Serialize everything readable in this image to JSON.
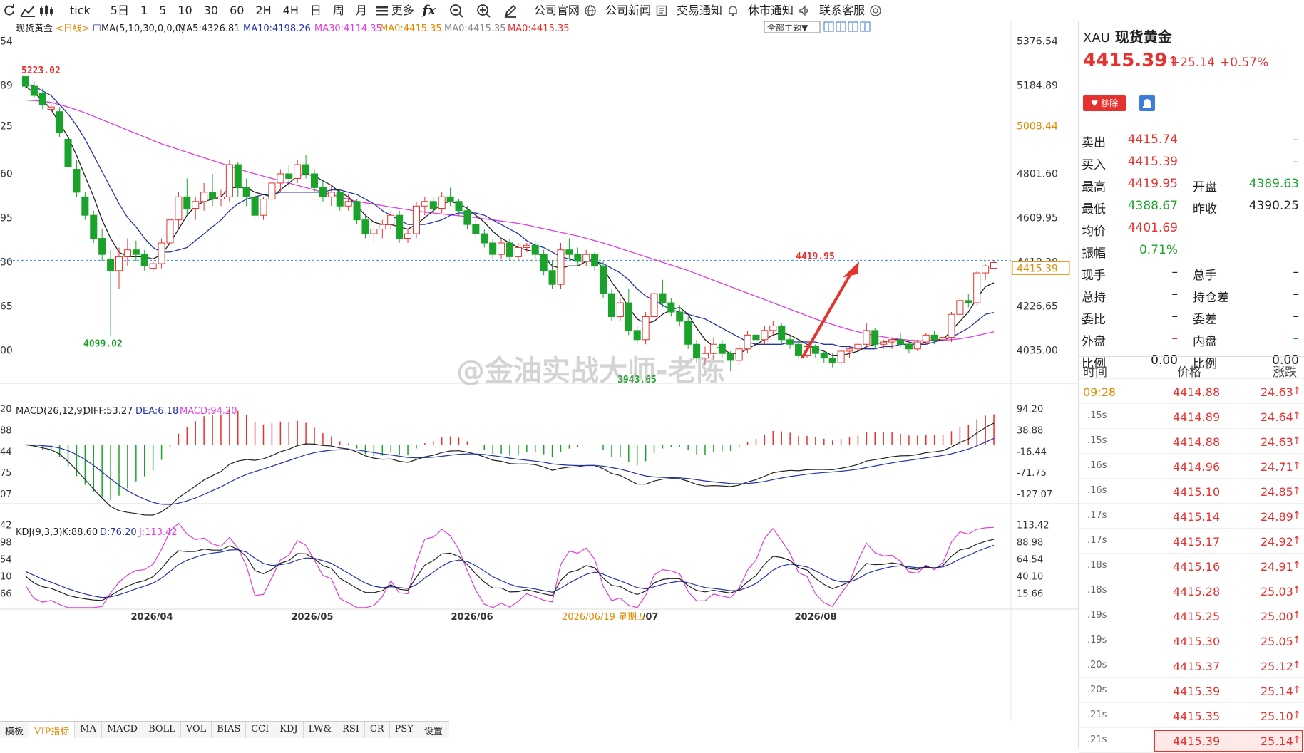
{
  "toolbar": {
    "items": [
      "tick",
      "5日",
      "1",
      "5",
      "10",
      "30",
      "60",
      "2H",
      "4H",
      "日",
      "周",
      "月",
      "更多",
      "公司官网",
      "公司新闻",
      "交易通知",
      "休市通知",
      "联系客服"
    ]
  },
  "chart_header": {
    "title": "现货黄金",
    "period": "<日线>",
    "ma_label": "MA(5,10,30,0,0,0)",
    "ma5": "MA5:4326.81",
    "ma10": "MA10:4198.26",
    "ma30": "MA30:4114.35",
    "ma0a": "MA0:4415.35",
    "ma0b": "MA0:4415.35",
    "ma0c": "MA0:4415.35",
    "theme_btn": "全部主题▼"
  },
  "price_axis": [
    "5376.54",
    "5184.89",
    "5008.44",
    "4801.60",
    "4609.95",
    "4418.30",
    "4226.65",
    "4035.00"
  ],
  "left_axis": [
    "54",
    "89",
    "25",
    "60",
    "95",
    "30",
    "65",
    "00"
  ],
  "current_price_tag": "4415.39",
  "annotations": {
    "high": "5223.02",
    "low1": "4099.02",
    "low2": "3943.65",
    "recent_high": "4419.95"
  },
  "macd": {
    "label": "MACD(26,12,9)",
    "diff": "DIFF:53.27",
    "dea": "DEA:6.18",
    "macd": "MACD:94.20",
    "axis": [
      "94.20",
      "38.88",
      "-16.44",
      "-71.75",
      "-127.07"
    ],
    "left": [
      "20",
      "88",
      "44",
      "75",
      "07"
    ]
  },
  "kdj": {
    "label": "KDJ(9,3,3)",
    "k": "K:88.60",
    "d": "D:76.20",
    "j": "J:113.42",
    "axis": [
      "113.42",
      "88.98",
      "64.54",
      "40.10",
      "15.66"
    ],
    "left": [
      "42",
      "98",
      "54",
      "10",
      "66"
    ]
  },
  "date_axis": [
    "2026/04",
    "2026/05",
    "2026/06",
    "/07",
    "2026/08"
  ],
  "crosshair_date": "2026/06/19 星期五",
  "bottom_tabs": [
    "模板",
    "VIP指标",
    "MA",
    "MACD",
    "BOLL",
    "VOL",
    "BIAS",
    "CCI",
    "KDJ",
    "LW&",
    "RSI",
    "CR",
    "PSY",
    "设置"
  ],
  "watermark": "@金油实战大师-老陈",
  "quote": {
    "symbol": "XAU",
    "name": "现货黄金",
    "price": "4415.39",
    "arrow": "↑",
    "change": "+25.14",
    "pct": "+0.57%",
    "remove": "移除",
    "rows": [
      {
        "l1": "卖出",
        "v1": "4415.74",
        "c1": "red",
        "l2": "",
        "v2": "–",
        "c2": "blk"
      },
      {
        "l1": "买入",
        "v1": "4415.39",
        "c1": "red",
        "l2": "",
        "v2": "–",
        "c2": "blk"
      },
      {
        "l1": "最高",
        "v1": "4419.95",
        "c1": "red",
        "l2": "开盘",
        "v2": "4389.63",
        "c2": "grn"
      },
      {
        "l1": "最低",
        "v1": "4388.67",
        "c1": "grn",
        "l2": "昨收",
        "v2": "4390.25",
        "c2": "blk"
      },
      {
        "l1": "均价",
        "v1": "4401.69",
        "c1": "red",
        "l2": "",
        "v2": "",
        "c2": "blk"
      },
      {
        "l1": "振幅",
        "v1": "0.71%",
        "c1": "grn",
        "l2": "",
        "v2": "",
        "c2": "blk"
      },
      {
        "l1": "现手",
        "v1": "–",
        "c1": "blk",
        "l2": "总手",
        "v2": "–",
        "c2": "blk"
      },
      {
        "l1": "总持",
        "v1": "–",
        "c1": "blk",
        "l2": "持仓差",
        "v2": "–",
        "c2": "blk"
      },
      {
        "l1": "委比",
        "v1": "–",
        "c1": "blk",
        "l2": "委差",
        "v2": "–",
        "c2": "blk"
      },
      {
        "l1": "外盘",
        "v1": "–",
        "c1": "red",
        "l2": "内盘",
        "v2": "–",
        "c2": "grn"
      },
      {
        "l1": "比例",
        "v1": "0.00",
        "c1": "blk",
        "l2": "比例",
        "v2": "0.00",
        "c2": "blk"
      }
    ],
    "tick_head": [
      "时间",
      "价格",
      "涨跌"
    ],
    "ticks": [
      {
        "t": "09:28",
        "p": "4414.88",
        "c": "24.63"
      },
      {
        "t": ".15s",
        "p": "4414.89",
        "c": "24.64"
      },
      {
        "t": ".15s",
        "p": "4414.88",
        "c": "24.63"
      },
      {
        "t": ".16s",
        "p": "4414.96",
        "c": "24.71"
      },
      {
        "t": ".16s",
        "p": "4415.10",
        "c": "24.85"
      },
      {
        "t": ".17s",
        "p": "4415.14",
        "c": "24.89"
      },
      {
        "t": ".17s",
        "p": "4415.17",
        "c": "24.92"
      },
      {
        "t": ".18s",
        "p": "4415.16",
        "c": "24.91"
      },
      {
        "t": ".18s",
        "p": "4415.28",
        "c": "25.03"
      },
      {
        "t": ".19s",
        "p": "4415.25",
        "c": "25.00"
      },
      {
        "t": ".19s",
        "p": "4415.30",
        "c": "25.05"
      },
      {
        "t": ".20s",
        "p": "4415.37",
        "c": "25.12"
      },
      {
        "t": ".20s",
        "p": "4415.39",
        "c": "25.14"
      },
      {
        "t": ".21s",
        "p": "4415.35",
        "c": "25.10"
      },
      {
        "t": ".21s",
        "p": "4415.39",
        "c": "25.14"
      }
    ]
  },
  "chart_data": {
    "type": "candlestick",
    "title": "现货黄金",
    "ylim": [
      3900,
      5400
    ],
    "candles": [
      [
        5223,
        5223,
        5170,
        5180
      ],
      [
        5180,
        5200,
        5130,
        5140
      ],
      [
        5150,
        5170,
        5080,
        5100
      ],
      [
        5080,
        5110,
        5060,
        5090
      ],
      [
        5070,
        5090,
        4960,
        4980
      ],
      [
        4950,
        4960,
        4820,
        4830
      ],
      [
        4820,
        4860,
        4700,
        4720
      ],
      [
        4700,
        4720,
        4600,
        4620
      ],
      [
        4620,
        4640,
        4500,
        4520
      ],
      [
        4520,
        4560,
        4420,
        4450
      ],
      [
        4430,
        4470,
        4099,
        4380
      ],
      [
        4380,
        4480,
        4300,
        4440
      ],
      [
        4440,
        4520,
        4400,
        4470
      ],
      [
        4470,
        4510,
        4420,
        4450
      ],
      [
        4450,
        4470,
        4380,
        4400
      ],
      [
        4390,
        4420,
        4370,
        4410
      ],
      [
        4410,
        4520,
        4390,
        4500
      ],
      [
        4500,
        4620,
        4480,
        4600
      ],
      [
        4600,
        4720,
        4560,
        4700
      ],
      [
        4700,
        4780,
        4620,
        4650
      ],
      [
        4650,
        4700,
        4600,
        4680
      ],
      [
        4680,
        4760,
        4640,
        4720
      ],
      [
        4720,
        4800,
        4660,
        4690
      ],
      [
        4690,
        4730,
        4660,
        4700
      ],
      [
        4700,
        4860,
        4680,
        4840
      ],
      [
        4840,
        4850,
        4700,
        4740
      ],
      [
        4740,
        4780,
        4660,
        4700
      ],
      [
        4700,
        4720,
        4600,
        4620
      ],
      [
        4620,
        4700,
        4600,
        4690
      ],
      [
        4690,
        4780,
        4670,
        4760
      ],
      [
        4760,
        4820,
        4720,
        4800
      ],
      [
        4800,
        4840,
        4740,
        4780
      ],
      [
        4780,
        4860,
        4760,
        4840
      ],
      [
        4840,
        4880,
        4780,
        4800
      ],
      [
        4800,
        4820,
        4720,
        4740
      ],
      [
        4740,
        4770,
        4680,
        4700
      ],
      [
        4700,
        4750,
        4660,
        4720
      ],
      [
        4720,
        4730,
        4640,
        4660
      ],
      [
        4660,
        4710,
        4640,
        4680
      ],
      [
        4680,
        4690,
        4580,
        4600
      ],
      [
        4600,
        4620,
        4520,
        4540
      ],
      [
        4540,
        4580,
        4500,
        4560
      ],
      [
        4560,
        4600,
        4520,
        4580
      ],
      [
        4580,
        4640,
        4560,
        4620
      ],
      [
        4620,
        4640,
        4500,
        4520
      ],
      [
        4520,
        4560,
        4500,
        4540
      ],
      [
        4540,
        4680,
        4520,
        4660
      ],
      [
        4660,
        4700,
        4620,
        4680
      ],
      [
        4680,
        4700,
        4630,
        4650
      ],
      [
        4650,
        4720,
        4630,
        4700
      ],
      [
        4700,
        4740,
        4660,
        4680
      ],
      [
        4680,
        4690,
        4620,
        4640
      ],
      [
        4640,
        4660,
        4560,
        4580
      ],
      [
        4580,
        4600,
        4520,
        4540
      ],
      [
        4540,
        4560,
        4480,
        4500
      ],
      [
        4500,
        4520,
        4430,
        4450
      ],
      [
        4450,
        4520,
        4430,
        4500
      ],
      [
        4500,
        4520,
        4420,
        4440
      ],
      [
        4440,
        4500,
        4420,
        4480
      ],
      [
        4480,
        4500,
        4460,
        4490
      ],
      [
        4490,
        4510,
        4430,
        4450
      ],
      [
        4450,
        4470,
        4360,
        4380
      ],
      [
        4380,
        4420,
        4300,
        4320
      ],
      [
        4320,
        4500,
        4300,
        4470
      ],
      [
        4470,
        4520,
        4430,
        4450
      ],
      [
        4450,
        4480,
        4400,
        4420
      ],
      [
        4420,
        4470,
        4400,
        4450
      ],
      [
        4450,
        4460,
        4380,
        4400
      ],
      [
        4400,
        4420,
        4260,
        4280
      ],
      [
        4280,
        4300,
        4160,
        4180
      ],
      [
        4180,
        4260,
        4160,
        4240
      ],
      [
        4240,
        4300,
        4100,
        4120
      ],
      [
        4120,
        4140,
        4060,
        4080
      ],
      [
        4080,
        4200,
        4060,
        4180
      ],
      [
        4180,
        4320,
        4160,
        4280
      ],
      [
        4280,
        4340,
        4220,
        4240
      ],
      [
        4240,
        4260,
        4180,
        4200
      ],
      [
        4200,
        4230,
        4140,
        4160
      ],
      [
        4160,
        4180,
        4040,
        4060
      ],
      [
        4060,
        4080,
        3980,
        4000
      ],
      [
        4000,
        4050,
        3970,
        4020
      ],
      [
        4020,
        4090,
        3990,
        4060
      ],
      [
        4060,
        4080,
        4000,
        4020
      ],
      [
        4020,
        4030,
        3943,
        3990
      ],
      [
        3990,
        4060,
        3970,
        4040
      ],
      [
        4040,
        4120,
        4020,
        4100
      ],
      [
        4100,
        4140,
        4060,
        4080
      ],
      [
        4080,
        4140,
        4060,
        4120
      ],
      [
        4120,
        4160,
        4100,
        4140
      ],
      [
        4140,
        4150,
        4060,
        4080
      ],
      [
        4080,
        4100,
        4040,
        4060
      ],
      [
        4060,
        4070,
        4000,
        4010
      ],
      [
        4010,
        4060,
        4000,
        4050
      ],
      [
        4050,
        4060,
        4000,
        4020
      ],
      [
        4020,
        4030,
        3980,
        4000
      ],
      [
        4000,
        4020,
        3960,
        3980
      ],
      [
        3980,
        4040,
        3970,
        4030
      ],
      [
        4030,
        4050,
        4000,
        4040
      ],
      [
        4040,
        4100,
        4020,
        4060
      ],
      [
        4060,
        4150,
        4040,
        4120
      ],
      [
        4120,
        4130,
        4040,
        4060
      ],
      [
        4060,
        4080,
        4040,
        4070
      ],
      [
        4070,
        4090,
        4040,
        4080
      ],
      [
        4080,
        4110,
        4050,
        4060
      ],
      [
        4060,
        4070,
        4020,
        4040
      ],
      [
        4040,
        4080,
        4030,
        4070
      ],
      [
        4070,
        4110,
        4060,
        4100
      ],
      [
        4100,
        4120,
        4060,
        4080
      ],
      [
        4080,
        4100,
        4050,
        4090
      ],
      [
        4090,
        4200,
        4070,
        4190
      ],
      [
        4190,
        4260,
        4180,
        4250
      ],
      [
        4250,
        4280,
        4220,
        4240
      ],
      [
        4240,
        4380,
        4230,
        4370
      ],
      [
        4370,
        4410,
        4340,
        4400
      ],
      [
        4390,
        4420,
        4388,
        4415
      ]
    ],
    "ma5": [
      5180,
      5150,
      5120,
      5080,
      5020,
      4960,
      4880,
      4790,
      4700,
      4600,
      4520,
      4460,
      4440,
      4440,
      4440,
      4430,
      4450,
      4500,
      4560,
      4620,
      4660,
      4680,
      4690,
      4700,
      4740,
      4740,
      4740,
      4720,
      4710,
      4700,
      4730,
      4760,
      4790,
      4800,
      4790,
      4770,
      4750,
      4720,
      4700,
      4660,
      4620,
      4590,
      4580,
      4580,
      4570,
      4560,
      4580,
      4610,
      4640,
      4670,
      4680,
      4670,
      4650,
      4620,
      4590,
      4550,
      4520,
      4500,
      4480,
      4470,
      4460,
      4440,
      4400,
      4390,
      4400,
      4400,
      4420,
      4430,
      4390,
      4330,
      4280,
      4220,
      4170,
      4150,
      4160,
      4190,
      4210,
      4220,
      4190,
      4130,
      4080,
      4050,
      4040,
      4020,
      4020,
      4040,
      4060,
      4080,
      4100,
      4110,
      4100,
      4080,
      4060,
      4040,
      4030,
      4010,
      4010,
      4020,
      4030,
      4050,
      4060,
      4070,
      4080,
      4080,
      4070,
      4060,
      4070,
      4080,
      4080,
      4120,
      4160,
      4200,
      4260,
      4310,
      4327
    ],
    "ma10": [
      5190,
      5180,
      5160,
      5140,
      5100,
      5060,
      5010,
      4950,
      4880,
      4810,
      4740,
      4670,
      4610,
      4570,
      4520,
      4480,
      4460,
      4460,
      4470,
      4480,
      4510,
      4540,
      4570,
      4600,
      4640,
      4670,
      4690,
      4700,
      4710,
      4710,
      4720,
      4720,
      4720,
      4720,
      4720,
      4720,
      4730,
      4730,
      4720,
      4710,
      4690,
      4670,
      4640,
      4620,
      4600,
      4580,
      4580,
      4580,
      4590,
      4600,
      4620,
      4630,
      4630,
      4630,
      4620,
      4600,
      4580,
      4560,
      4540,
      4510,
      4490,
      4480,
      4460,
      4440,
      4430,
      4420,
      4420,
      4420,
      4410,
      4390,
      4370,
      4340,
      4300,
      4270,
      4250,
      4230,
      4210,
      4200,
      4190,
      4180,
      4170,
      4150,
      4130,
      4110,
      4090,
      4070,
      4060,
      4060,
      4060,
      4060,
      4070,
      4070,
      4070,
      4070,
      4060,
      4060,
      4050,
      4050,
      4040,
      4040,
      4040,
      4050,
      4050,
      4060,
      4060,
      4060,
      4060,
      4070,
      4080,
      4090,
      4110,
      4130,
      4160,
      4190,
      4198
    ],
    "ma30": [
      5120,
      5118,
      5115,
      5110,
      5100,
      5090,
      5078,
      5065,
      5050,
      5035,
      5020,
      5005,
      4990,
      4975,
      4960,
      4945,
      4930,
      4918,
      4906,
      4894,
      4882,
      4870,
      4858,
      4846,
      4834,
      4822,
      4810,
      4800,
      4790,
      4780,
      4770,
      4760,
      4750,
      4740,
      4730,
      4720,
      4710,
      4700,
      4690,
      4680,
      4674,
      4668,
      4662,
      4656,
      4650,
      4644,
      4638,
      4634,
      4630,
      4626,
      4622,
      4618,
      4614,
      4610,
      4605,
      4600,
      4595,
      4590,
      4585,
      4578,
      4570,
      4562,
      4554,
      4546,
      4538,
      4530,
      4520,
      4510,
      4500,
      4488,
      4476,
      4464,
      4452,
      4440,
      4428,
      4416,
      4404,
      4392,
      4380,
      4366,
      4352,
      4338,
      4324,
      4310,
      4296,
      4282,
      4268,
      4254,
      4240,
      4226,
      4212,
      4198,
      4184,
      4170,
      4158,
      4146,
      4134,
      4124,
      4114,
      4106,
      4098,
      4092,
      4086,
      4082,
      4078,
      4076,
      4076,
      4076,
      4078,
      4080,
      4084,
      4090,
      4098,
      4106,
      4114
    ]
  }
}
